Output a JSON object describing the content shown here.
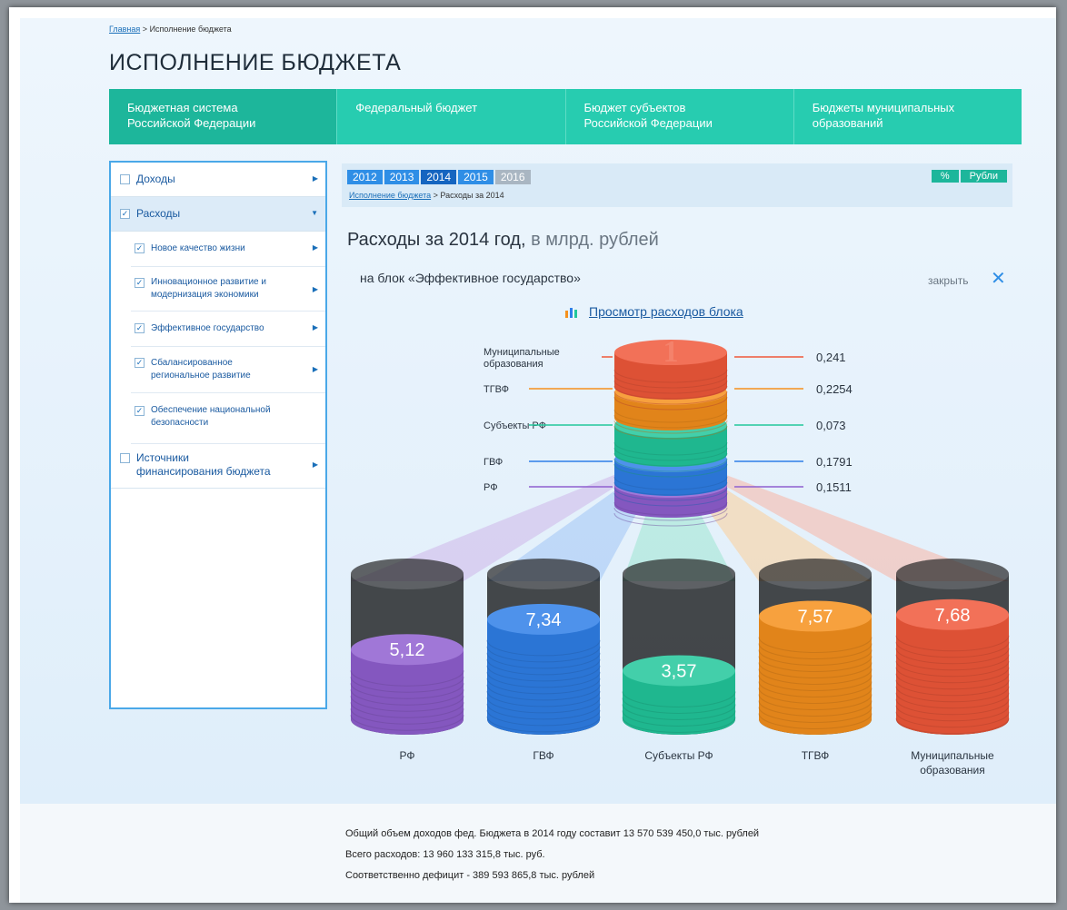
{
  "breadcrumb": {
    "home": "Главная",
    "current": "Исполнение бюджета"
  },
  "page_title": "ИСПОЛНЕНИЕ БЮДЖЕТА",
  "top_tabs": [
    {
      "label": "Бюджетная система Российской Федерации",
      "line1": "Бюджетная система",
      "line2": "Российской Федерации",
      "active": true
    },
    {
      "label": "Федеральный бюджет",
      "line1": "Федеральный бюджет",
      "line2": "",
      "active": false
    },
    {
      "label": "Бюджет субъектов Российской Федерации",
      "line1": "Бюджет субъектов",
      "line2": "Российской Федерации",
      "active": false
    },
    {
      "label": "Бюджеты муниципальных образований",
      "line1": "Бюджеты муниципальных",
      "line2": "образований",
      "active": false
    }
  ],
  "sidebar": {
    "items": [
      {
        "label": "Доходы",
        "checked": false
      },
      {
        "label": "Расходы",
        "checked": true
      },
      {
        "label": "Источники финансирования бюджета",
        "line1": "Источники",
        "line2": "финансирования бюджета",
        "checked": false
      }
    ],
    "sub_items": [
      {
        "line1": "Новое качество жизни",
        "line2": ""
      },
      {
        "line1": "Инновационное развитие и",
        "line2": "модернизация экономики"
      },
      {
        "line1": "Эффективное государство",
        "line2": ""
      },
      {
        "line1": "Сбалансированное",
        "line2": "региональное развитие"
      },
      {
        "line1": "Обеспечение национальной",
        "line2": "безопасности"
      }
    ]
  },
  "years": [
    "2012",
    "2013",
    "2014",
    "2015",
    "2016"
  ],
  "selected_year": "2014",
  "disabled_year": "2016",
  "sub_breadcrumb": {
    "link": "Исполнение бюджета",
    "current": "Расходы за 2014"
  },
  "units": [
    "%",
    "Рубли"
  ],
  "expenses_title": {
    "main": "Расходы за 2014 год,",
    "unit": "в млрд. рублей"
  },
  "block": {
    "name": "на блок «Эффективное государство»",
    "close_label": "закрыть",
    "view_link": "Просмотр расходов блока"
  },
  "colors": {
    "accent": "#27ccb0",
    "blue": "#2f8ee6"
  },
  "chart_data": {
    "type": "bar",
    "categories": [
      "РФ",
      "ГВФ",
      "Субъекты РФ",
      "ТГВФ",
      "Муниципальные образования"
    ],
    "category_lines": [
      [
        "РФ"
      ],
      [
        "ГВФ"
      ],
      [
        "Субъекты РФ"
      ],
      [
        "ТГВФ"
      ],
      [
        "Муниципальные",
        "образования"
      ]
    ],
    "values": [
      5.12,
      7.34,
      3.57,
      7.57,
      7.68
    ],
    "value_labels": [
      "5,12",
      "7,34",
      "3,57",
      "7,57",
      "7,68"
    ],
    "colors": [
      "#8f5fd0",
      "#2f7fe8",
      "#22c79b",
      "#f5901c",
      "#f0583a"
    ],
    "stack_block": {
      "stack_number": "1",
      "labels": [
        "Муниципальные образования",
        "ТГВФ",
        "Субъекты РФ",
        "ГВФ",
        "РФ"
      ],
      "label_lines": [
        [
          "Муниципальные",
          "образования"
        ],
        [
          "ТГВФ"
        ],
        [
          "Субъекты РФ"
        ],
        [
          "ГВФ"
        ],
        [
          "РФ"
        ]
      ],
      "values": [
        0.241,
        0.2254,
        0.073,
        0.1791,
        0.1511
      ],
      "value_labels": [
        "0,241",
        "0,2254",
        "0,073",
        "0,1791",
        "0,1511"
      ],
      "colors": [
        "#f0583a",
        "#f5901c",
        "#22c79b",
        "#2f7fe8",
        "#8f5fd0"
      ]
    }
  },
  "footer": {
    "line1": "Общий объем доходов фед. Бюджета  в 2014 году составит 13 570 539 450,0 тыс. рублей",
    "line2": "Всего расходов: 13 960 133 315,8 тыс. руб.",
    "line3": "Соответственно дефицит - 389 593 865,8 тыс. рублей"
  }
}
